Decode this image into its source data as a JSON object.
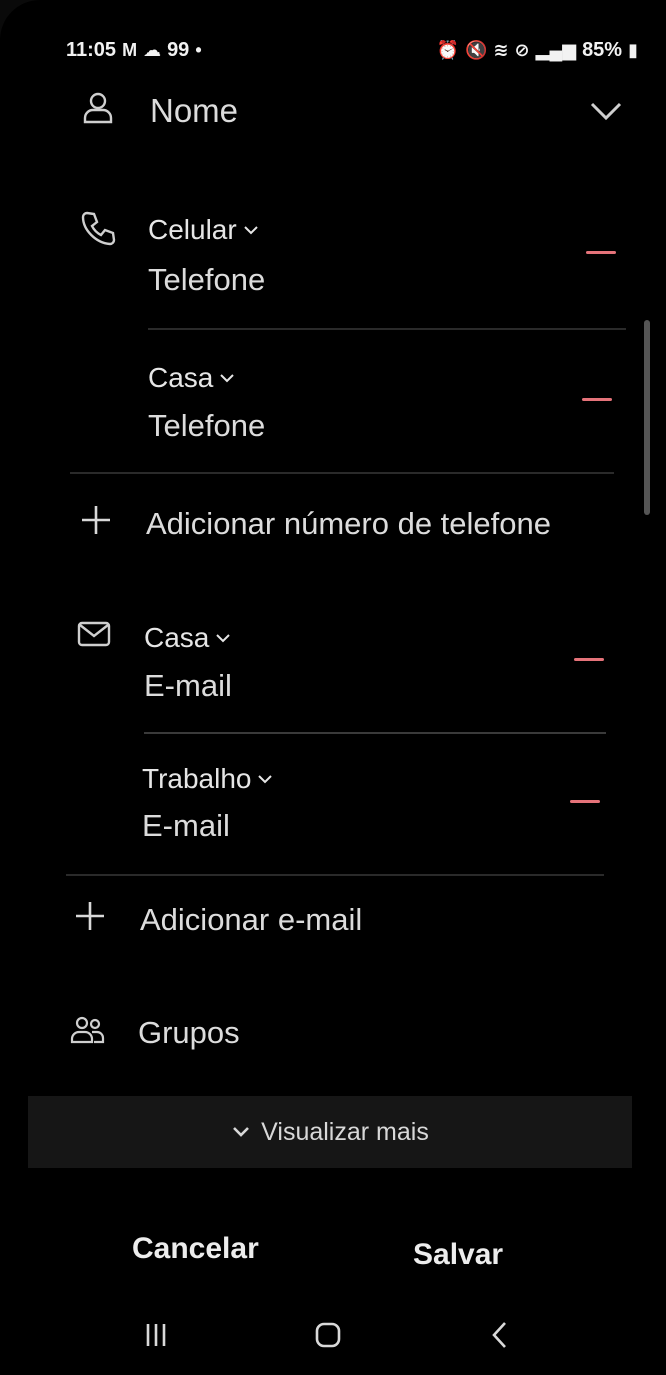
{
  "status_bar": {
    "time": "11:05",
    "notif_count": "99",
    "battery": "85%"
  },
  "name_field": {
    "placeholder": "Nome"
  },
  "phones": [
    {
      "type": "Celular",
      "placeholder": "Telefone"
    },
    {
      "type": "Casa",
      "placeholder": "Telefone"
    }
  ],
  "add_phone_label": "Adicionar número de telefone",
  "emails": [
    {
      "type": "Casa",
      "placeholder": "E-mail"
    },
    {
      "type": "Trabalho",
      "placeholder": "E-mail"
    }
  ],
  "add_email_label": "Adicionar e-mail",
  "groups_label": "Grupos",
  "view_more_label": "Visualizar mais",
  "actions": {
    "cancel": "Cancelar",
    "save": "Salvar"
  },
  "colors": {
    "background": "#000000",
    "remove_accent": "#e5737a",
    "panel": "#161616"
  },
  "icons": [
    "person-icon",
    "phone-icon",
    "plus-icon",
    "mail-icon",
    "group-icon",
    "chevron-down-icon",
    "recents-icon",
    "home-icon",
    "back-icon"
  ]
}
